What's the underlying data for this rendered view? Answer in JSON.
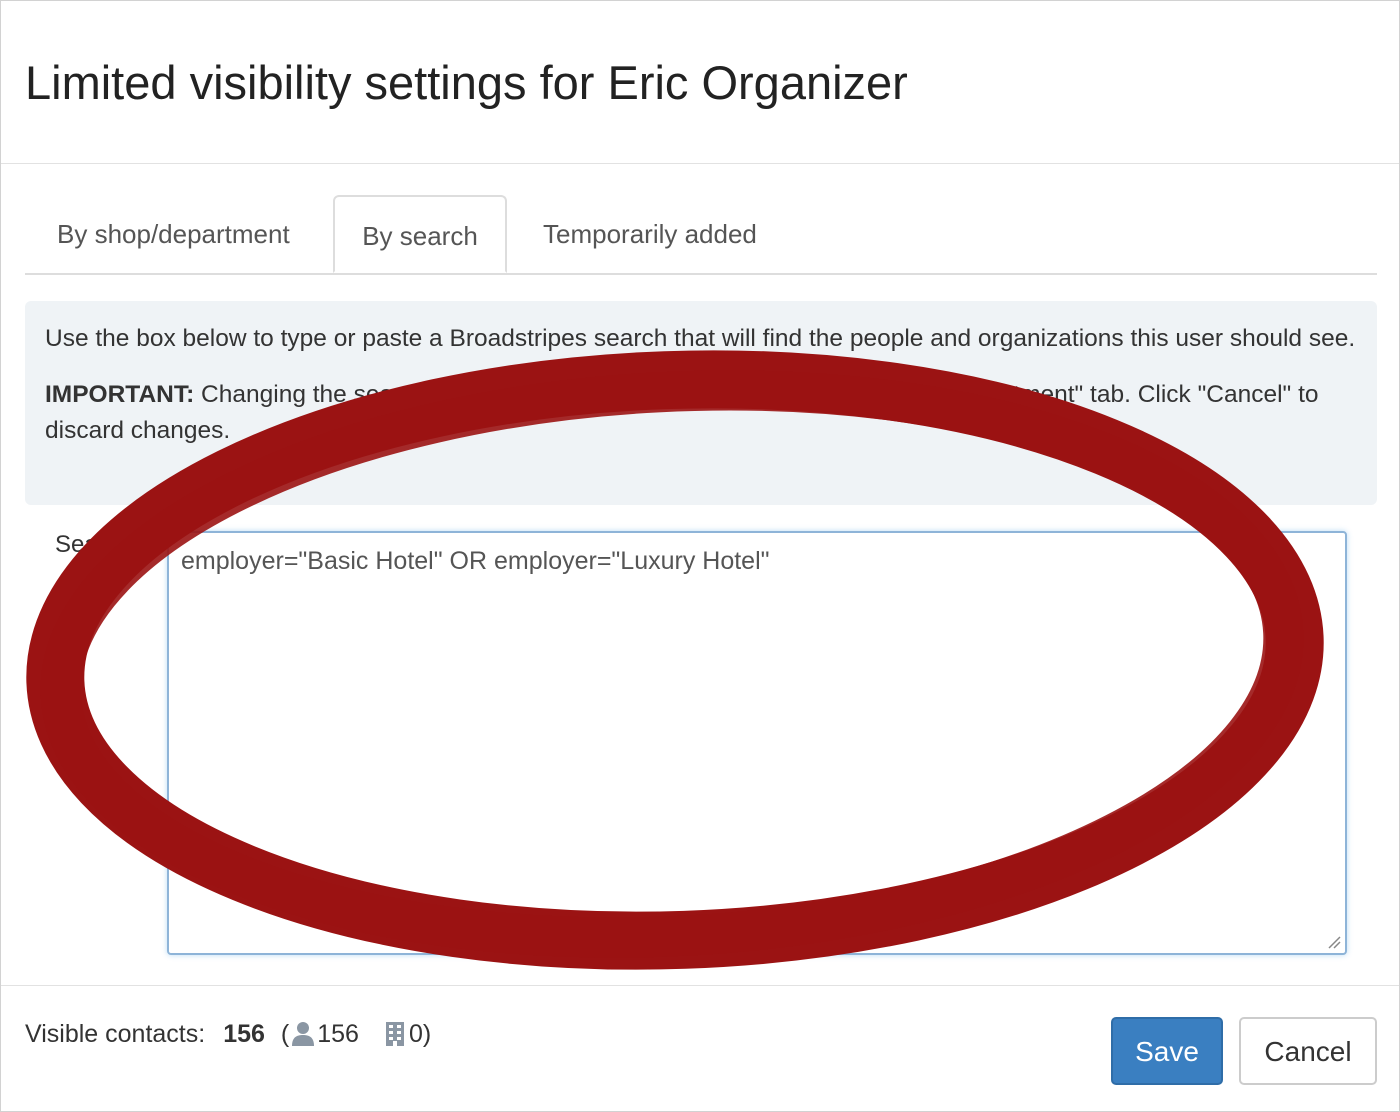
{
  "modal": {
    "title": "Limited visibility settings for Eric Organizer"
  },
  "tabs": [
    {
      "label": "By shop/department",
      "active": false
    },
    {
      "label": "By search",
      "active": true
    },
    {
      "label": "Temporarily added",
      "active": false
    }
  ],
  "info": {
    "description": "Use the box below to type or paste a Broadstripes search that will find the people and organizations this user should see.",
    "important_label": "IMPORTANT:",
    "important_text": " Changing the search text will clear any assignments on the \"By shop/department\" tab. Click \"Cancel\" to discard changes."
  },
  "search": {
    "label": "Search",
    "value": "employer=\"Basic Hotel\" OR employer=\"Luxury Hotel\""
  },
  "footer": {
    "visible_contacts_label": "Visible contacts:",
    "total": "156",
    "open_paren": "(",
    "people_count": "156",
    "org_count": "0",
    "close_paren": ")",
    "save_label": "Save",
    "cancel_label": "Cancel"
  },
  "colors": {
    "accent": "#3a7fc1",
    "annotation_red": "#9b1313"
  },
  "icons": {
    "people": "person-icon",
    "organizations": "building-icon"
  }
}
